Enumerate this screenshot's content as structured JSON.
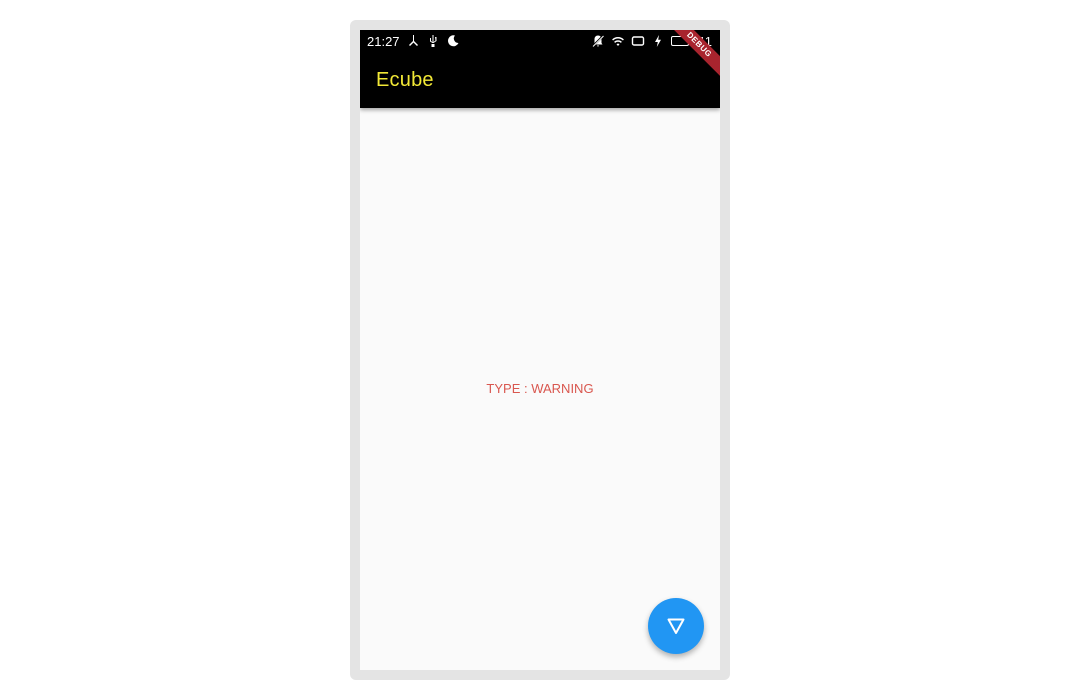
{
  "status_bar": {
    "time": "21:27",
    "battery_level": "11",
    "left_icons": [
      "fork-icon",
      "usb-icon",
      "moon-icon"
    ],
    "right_icons": [
      "notifications-off-icon",
      "wifi-icon",
      "screen-icon",
      "charging-icon",
      "battery-icon"
    ]
  },
  "app_bar": {
    "title": "Ecube",
    "title_color": "#f2e836",
    "background": "#000000"
  },
  "debug_banner": {
    "label": "DEBUG",
    "color": "#a8242e"
  },
  "main": {
    "message": "TYPE : WARNING",
    "message_color": "#d9574f"
  },
  "fab": {
    "icon": "filter-triangle-icon",
    "color": "#2196f3"
  }
}
